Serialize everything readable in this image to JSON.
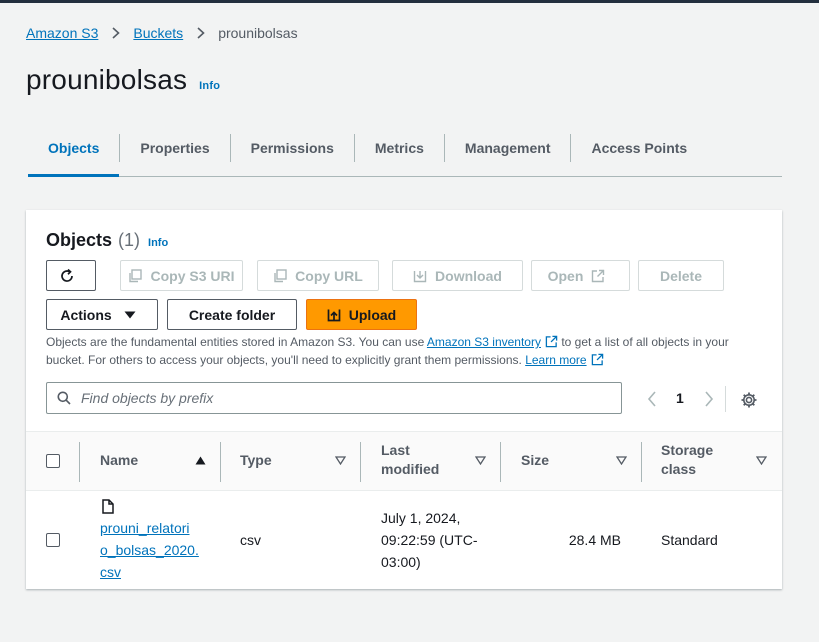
{
  "breadcrumb": {
    "root": "Amazon S3",
    "buckets": "Buckets",
    "current": "prounibolsas"
  },
  "page": {
    "title": "prounibolsas",
    "info": "Info"
  },
  "tabs": [
    "Objects",
    "Properties",
    "Permissions",
    "Metrics",
    "Management",
    "Access Points"
  ],
  "objects_panel": {
    "title": "Objects",
    "count": "(1)",
    "info": "Info",
    "buttons": {
      "copy_s3_uri": "Copy S3 URI",
      "copy_url": "Copy URL",
      "download": "Download",
      "open": "Open",
      "delete": "Delete",
      "actions": "Actions",
      "create_folder": "Create folder",
      "upload": "Upload"
    },
    "description": {
      "part1": "Objects are the fundamental entities stored in Amazon S3. You can use ",
      "inventory_link": "Amazon S3 inventory",
      "part2": " to get a list of all objects in your bucket. For others to access your objects, you'll need to explicitly grant them permissions. ",
      "learn_more": "Learn more"
    },
    "search_placeholder": "Find objects by prefix",
    "page_number": "1"
  },
  "table": {
    "columns": {
      "name": "Name",
      "type": "Type",
      "last_modified_1": "Last",
      "last_modified_2": "modified",
      "size": "Size",
      "storage_1": "Storage",
      "storage_2": "class"
    },
    "rows": [
      {
        "name_1": "prouni_relatori",
        "name_2": "o_bolsas_2020.",
        "name_3": "csv",
        "type": "csv",
        "modified_1": "July 1, 2024,",
        "modified_2": "09:22:59 (UTC-",
        "modified_3": "03:00)",
        "size": "28.4 MB",
        "storage_class": "Standard"
      }
    ]
  },
  "colors": {
    "link": "#0073bb",
    "primary": "#ff9900",
    "text": "#16191f",
    "muted": "#545b64",
    "disabled": "#aab7b8"
  }
}
